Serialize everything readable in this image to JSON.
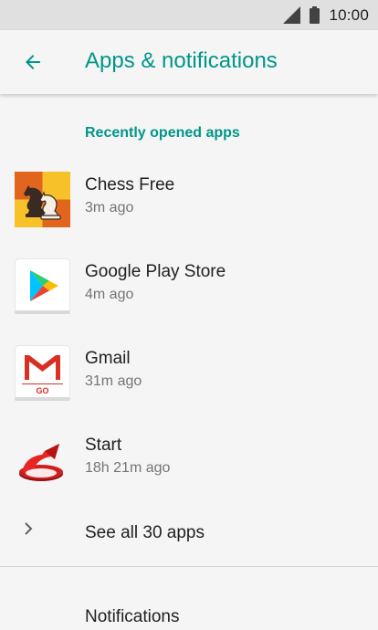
{
  "status_bar": {
    "time": "10:00",
    "signal_icon": "signal-icon",
    "battery_icon": "battery-icon"
  },
  "header": {
    "title": "Apps & notifications",
    "back_icon": "arrow-back-icon"
  },
  "recent": {
    "section_title": "Recently opened apps",
    "apps": [
      {
        "name": "Chess Free",
        "time": "3m ago",
        "icon": "chess-free-icon"
      },
      {
        "name": "Google Play Store",
        "time": "4m ago",
        "icon": "play-store-icon"
      },
      {
        "name": "Gmail",
        "time": "31m ago",
        "icon": "gmail-go-icon",
        "icon_text": "GO"
      },
      {
        "name": "Start",
        "time": "18h 21m ago",
        "icon": "start-icon"
      }
    ]
  },
  "see_all": {
    "label": "See all 30 apps",
    "icon": "chevron-right-icon"
  },
  "notifications": {
    "label": "Notifications"
  },
  "colors": {
    "accent": "#009688",
    "background": "#f5f5f5",
    "status_bar": "#e0e0e0",
    "primary_text": "#212121",
    "secondary_text": "#757575"
  }
}
